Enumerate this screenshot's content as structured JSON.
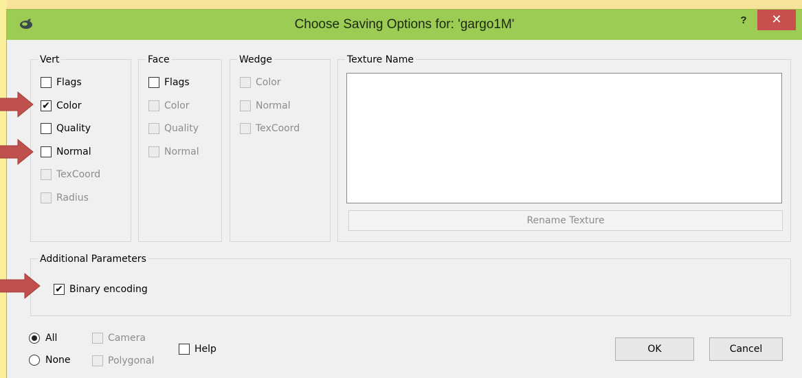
{
  "window": {
    "title": "Choose Saving Options for: 'gargo1M'",
    "help_label": "?",
    "close_label": "✕"
  },
  "vert": {
    "title": "Vert",
    "items": [
      {
        "label": "Flags",
        "checked": false,
        "enabled": true
      },
      {
        "label": "Color",
        "checked": true,
        "enabled": true
      },
      {
        "label": "Quality",
        "checked": false,
        "enabled": true
      },
      {
        "label": "Normal",
        "checked": false,
        "enabled": true
      },
      {
        "label": "TexCoord",
        "checked": false,
        "enabled": false
      },
      {
        "label": "Radius",
        "checked": false,
        "enabled": false
      }
    ]
  },
  "face": {
    "title": "Face",
    "items": [
      {
        "label": "Flags",
        "checked": false,
        "enabled": true
      },
      {
        "label": "Color",
        "checked": false,
        "enabled": false
      },
      {
        "label": "Quality",
        "checked": false,
        "enabled": false
      },
      {
        "label": "Normal",
        "checked": false,
        "enabled": false
      }
    ]
  },
  "wedge": {
    "title": "Wedge",
    "items": [
      {
        "label": "Color",
        "checked": false,
        "enabled": false
      },
      {
        "label": "Normal",
        "checked": false,
        "enabled": false
      },
      {
        "label": "TexCoord",
        "checked": false,
        "enabled": false
      }
    ]
  },
  "texture": {
    "title": "Texture Name",
    "rename_label": "Rename Texture"
  },
  "additional": {
    "title": "Additional Parameters",
    "binary_label": "Binary encoding",
    "binary_checked": true
  },
  "bottom": {
    "all_label": "All",
    "none_label": "None",
    "camera_label": "Camera",
    "polygonal_label": "Polygonal",
    "help_label": "Help",
    "ok_label": "OK",
    "cancel_label": "Cancel"
  },
  "colors": {
    "titlebar": "#9ccc53",
    "close": "#c7504e",
    "arrow": "#c0504d",
    "background": "#fdf3b4"
  }
}
